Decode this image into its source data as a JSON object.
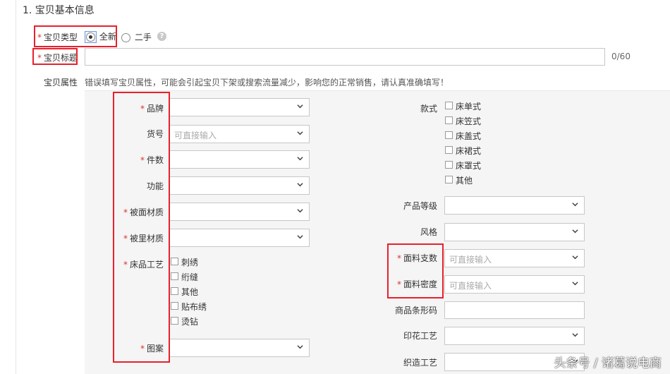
{
  "section": {
    "title": "1. 宝贝基本信息"
  },
  "required_mark": "*",
  "item_type": {
    "label": "宝贝类型",
    "options": [
      {
        "label": "全新",
        "selected": true
      },
      {
        "label": "二手",
        "selected": false
      }
    ],
    "help_icon": "question-circle-icon",
    "help_glyph": "?"
  },
  "item_title": {
    "label": "宝贝标题",
    "value": "",
    "counter": "0/60"
  },
  "attributes": {
    "label": "宝贝属性",
    "notice": "错误填写宝贝属性，可能会引起宝贝下架或搜索流量减少，影响您的正常销售，请认真准确填写！"
  },
  "left_fields": {
    "brand": {
      "label": "品牌",
      "required": true,
      "value": ""
    },
    "item_no": {
      "label": "货号",
      "required": false,
      "placeholder": "可直接输入"
    },
    "piece_count": {
      "label": "件数",
      "required": true,
      "value": ""
    },
    "function": {
      "label": "功能",
      "required": false,
      "value": ""
    },
    "cover_material": {
      "label": "被面材质",
      "required": true,
      "value": ""
    },
    "lining_material": {
      "label": "被里材质",
      "required": true,
      "value": ""
    },
    "craft": {
      "label": "床品工艺",
      "required": true,
      "options": [
        "刺绣",
        "绗缝",
        "其他",
        "贴布绣",
        "烫钻"
      ]
    },
    "pattern": {
      "label": "图案",
      "required": true,
      "value": ""
    }
  },
  "right_fields": {
    "style": {
      "label": "款式",
      "required": false,
      "options": [
        "床单式",
        "床笠式",
        "床盖式",
        "床裙式",
        "床罩式",
        "其他"
      ]
    },
    "grade": {
      "label": "产品等级",
      "required": false,
      "value": ""
    },
    "look": {
      "label": "风格",
      "required": false,
      "value": ""
    },
    "fabric_count": {
      "label": "面料支数",
      "required": true,
      "placeholder": "可直接输入"
    },
    "fabric_density": {
      "label": "面料密度",
      "required": true,
      "placeholder": "可直接输入"
    },
    "barcode": {
      "label": "商品条形码",
      "required": false,
      "value": ""
    },
    "print_craft": {
      "label": "印花工艺",
      "required": false,
      "value": ""
    },
    "weave_craft": {
      "label": "织造工艺",
      "required": false,
      "value": ""
    }
  },
  "icons": {
    "dropdown": "chevron-down-icon",
    "radio": "radio-icon",
    "checkbox": "checkbox-icon"
  },
  "colors": {
    "required": "#d9342b",
    "highlight_box": "#e8202c",
    "panel_bg": "#f5f5f5"
  },
  "watermark": "头条号 / 诸葛说电商"
}
